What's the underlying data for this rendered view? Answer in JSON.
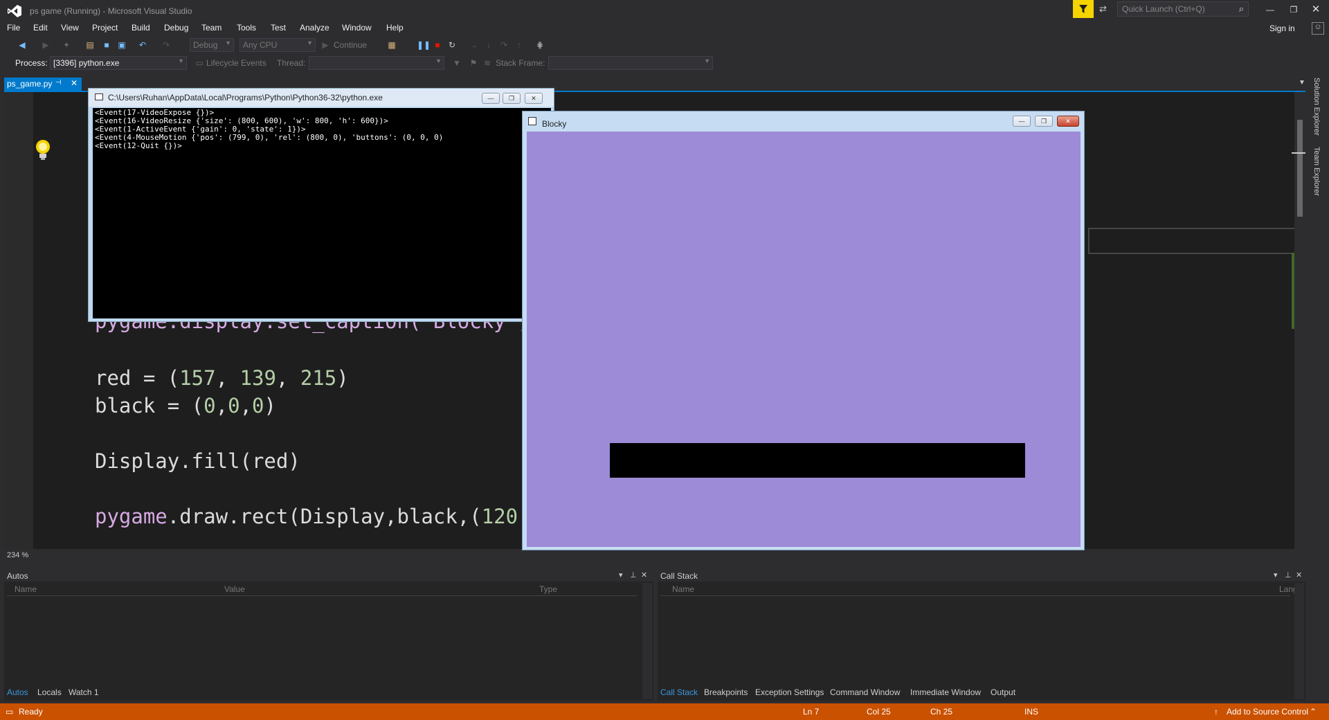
{
  "window": {
    "title": "ps game (Running) - Microsoft Visual Studio",
    "quick_launch_placeholder": "Quick Launch (Ctrl+Q)",
    "sign_in": "Sign in"
  },
  "menu": [
    "File",
    "Edit",
    "View",
    "Project",
    "Build",
    "Debug",
    "Team",
    "Tools",
    "Test",
    "Analyze",
    "Window",
    "Help"
  ],
  "toolbar": {
    "config": "Debug",
    "platform": "Any CPU",
    "continue_label": "Continue",
    "process_label": "Process:",
    "process_value": "[3396] python.exe",
    "lifecycle_label": "Lifecycle Events",
    "thread_label": "Thread:",
    "stackframe_label": "Stack Frame:"
  },
  "editor": {
    "tab_name": "ps_game.py",
    "zoom": "234 %",
    "code_lines": [
      "pygame.display.set_caption('Blocky')",
      "red = (157, 139, 215)",
      "black = (0,0,0)",
      "Display.fill(red)",
      "pygame.draw.rect(Display,black,(120,4"
    ]
  },
  "console": {
    "title": "C:\\Users\\Ruhan\\AppData\\Local\\Programs\\Python\\Python36-32\\python.exe",
    "lines": [
      "<Event(17-VideoExpose {})>",
      "<Event(16-VideoResize {'size': (800, 600), 'w': 800, 'h': 600})>",
      "<Event(1-ActiveEvent {'gain': 0, 'state': 1})>",
      "<Event(4-MouseMotion {'pos': (799, 0), 'rel': (800, 0), 'buttons': (0, 0, 0)",
      "<Event(12-Quit {})>"
    ]
  },
  "blocky": {
    "title": "Blocky",
    "fill_color": "#9d8bd7",
    "rect_color": "#000000"
  },
  "autos": {
    "title": "Autos",
    "columns": [
      "Name",
      "Value",
      "Type"
    ]
  },
  "callstack": {
    "title": "Call Stack",
    "columns": [
      "Name",
      "Lang"
    ]
  },
  "bottom_tabs_left": [
    "Autos",
    "Locals",
    "Watch 1"
  ],
  "bottom_tabs_right": [
    "Call Stack",
    "Breakpoints",
    "Exception Settings",
    "Command Window",
    "Immediate Window",
    "Output"
  ],
  "side_tabs": [
    "Solution Explorer",
    "Team Explorer"
  ],
  "status": {
    "ready": "Ready",
    "ln": "Ln 7",
    "col": "Col 25",
    "ch": "Ch 25",
    "ins": "INS",
    "source_control": "Add to Source Control"
  },
  "colors": {
    "accent": "#007acc",
    "status_bar": "#ca5100",
    "editor_bg": "#1e1e1e"
  }
}
